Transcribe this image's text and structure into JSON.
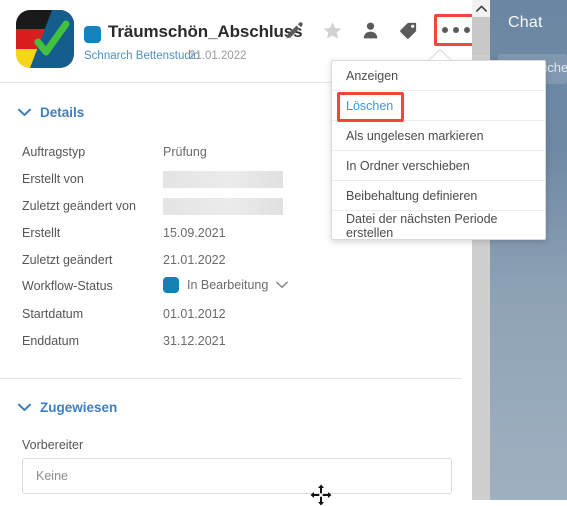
{
  "background": {
    "chat_label": "Chat",
    "search_label": "uche",
    "panel_color": "#6b87a3"
  },
  "header": {
    "app_icon_name": "german-flag-check-icon",
    "badge_color": "#1384bf",
    "title": "Träumschön_Abschluss",
    "client": "Schnarch Bettenstudio",
    "date": "21.01.2022",
    "toolbar": [
      {
        "name": "edit-pencil-icon",
        "label": "Bearbeiten"
      },
      {
        "name": "star-icon",
        "label": "Favorit"
      },
      {
        "name": "person-icon",
        "label": "Kontakt"
      },
      {
        "name": "tag-icon",
        "label": "Tag"
      },
      {
        "name": "more-options-icon",
        "label": "Weitere Optionen"
      }
    ]
  },
  "details": {
    "heading": "Details",
    "chevron": "chevron-down-icon",
    "rows": [
      {
        "label": "Auftragstyp",
        "value": "Prüfung",
        "type": "text"
      },
      {
        "label": "Erstellt von",
        "value": "",
        "type": "redacted"
      },
      {
        "label": "Zuletzt geändert von",
        "value": "",
        "type": "redacted"
      },
      {
        "label": "Erstellt",
        "value": "15.09.2021",
        "type": "text"
      },
      {
        "label": "Zuletzt geändert",
        "value": "21.01.2022",
        "type": "text"
      },
      {
        "label": "Workflow-Status",
        "value": "In Bearbeitung",
        "type": "status",
        "status_color": "#1581b5"
      },
      {
        "label": "Startdatum",
        "value": "01.01.2012",
        "type": "text"
      },
      {
        "label": "Enddatum",
        "value": "31.12.2021",
        "type": "text"
      }
    ]
  },
  "assigned": {
    "heading": "Zugewiesen",
    "field_label": "Vorbereiter",
    "field_value": "Keine"
  },
  "dropdown_menu": {
    "items": [
      {
        "label": "Anzeigen",
        "highlighted": false
      },
      {
        "label": "Löschen",
        "highlighted": true
      },
      {
        "label": "Als ungelesen markieren",
        "highlighted": false
      },
      {
        "label": "In Ordner verschieben",
        "highlighted": false
      },
      {
        "label": "Beibehaltung definieren",
        "highlighted": false
      },
      {
        "label": "Datei der nächsten Periode erstellen",
        "highlighted": false
      }
    ],
    "highlight_color": "#f4453d",
    "highlight_text_color": "#3f97e0"
  },
  "scrollbar": {
    "up_arrow": "chevron-up-icon"
  },
  "cursor": {
    "type": "move-cursor"
  }
}
